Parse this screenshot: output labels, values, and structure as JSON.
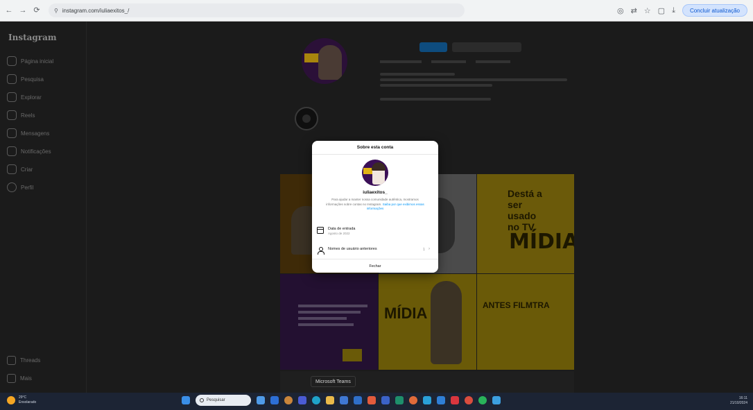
{
  "browser": {
    "url": "instagram.com/iuliaexitos_/",
    "finish_label": "Concluir atualização"
  },
  "instagram": {
    "logo": "Instagram",
    "sidebar_items": [
      "Página inicial",
      "Pesquisa",
      "Explorar",
      "Reels",
      "Mensagens",
      "Notificações",
      "Criar",
      "Perfil"
    ],
    "sidebar_bottom": [
      "Threads",
      "Mais"
    ],
    "tile_text": {
      "t3_title": "Destá a ser usado no TV",
      "t3_word": "MÍDIA",
      "t5_word": "MÍDIA",
      "t6_title": "ANTES FILMTRA"
    }
  },
  "modal": {
    "title": "Sobre esta conta",
    "username": "iuliaexitos_",
    "description": "Para ajudar a manter nossa comunidade autêntica, mostramos informações sobre contas no Instagram. ",
    "description_link": "Saiba por que exibimos essas informações",
    "rows": [
      {
        "label": "Data de entrada",
        "sub": "Agosto de 2022",
        "icon": "calendar-icon"
      },
      {
        "label": "Nomes de usuário anteriores",
        "sub": "",
        "icon": "person-icon",
        "count": "1"
      }
    ],
    "close_label": "Fechar"
  },
  "tooltip": "Microsoft Teams",
  "taskbar": {
    "weather_temp": "29°C",
    "weather_desc": "Ensolarado",
    "search_placeholder": "Pesquisar",
    "time": "16:11",
    "date": "21/10/2024"
  }
}
